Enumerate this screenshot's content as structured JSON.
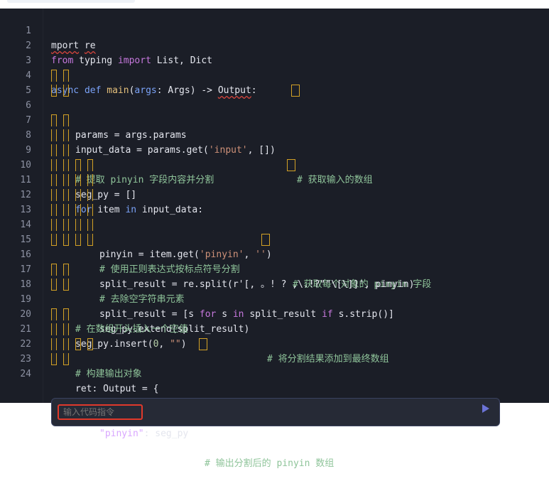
{
  "lines": [
    {
      "n": "1",
      "t": "mport re"
    },
    {
      "n": "2",
      "t": "from typing import List, Dict"
    },
    {
      "n": "3",
      "t": ""
    },
    {
      "n": "4",
      "t": "async def main(args: Args) -> Output:"
    },
    {
      "n": "5",
      "t": "params = args.params"
    },
    {
      "n": "6",
      "t": "input_data = params.get('input', [])",
      "c": "# 获取输入的数组"
    },
    {
      "n": "7",
      "t": ""
    },
    {
      "n": "8",
      "t": "",
      "c": "# 提取 pinyin 字段内容并分割"
    },
    {
      "n": "9",
      "t": "seg_py = []"
    },
    {
      "n": "10",
      "t": "for item in input_data:"
    },
    {
      "n": "11",
      "t": "pinyin = item.get('pinyin', '')",
      "c": "# 获取每个对象的 pinyin 字段"
    },
    {
      "n": "12",
      "t": "",
      "c": "# 使用正则表达式按标点符号分割"
    },
    {
      "n": "13",
      "t": "split_result = re.split(r'[, 。! ? ,\\.!?\"\"\\[\\]]', pinyin)"
    },
    {
      "n": "14",
      "t": "",
      "c": "# 去除空字符串元素"
    },
    {
      "n": "15",
      "t": "split_result = [s for s in split_result if s.strip()]"
    },
    {
      "n": "16",
      "t": "seg_py.extend(split_result)",
      "c": "# 将分割结果添加到最终数组"
    },
    {
      "n": "17",
      "t": ""
    },
    {
      "n": "18",
      "t": "",
      "c": "# 在数组开头插入一个空值"
    },
    {
      "n": "19",
      "t": "seg_py.insert(0, \"\")"
    },
    {
      "n": "20",
      "t": ""
    },
    {
      "n": "21",
      "t": "",
      "c": "# 构建输出对象"
    },
    {
      "n": "22",
      "t": "ret: Output = {"
    },
    {
      "n": "23",
      "t": "\"pinyin\": seg_py",
      "c": "# 输出分割后的 pinyin 数组"
    },
    {
      "n": "24",
      "t": "}"
    }
  ],
  "chat": {
    "placeholder": "输入代码指令"
  },
  "colors": {
    "background": "#1b1e27",
    "guide": "#d3a126",
    "comment": "#8fc49a",
    "keyword": "#c678dd",
    "highlight_border": "#e0392b"
  }
}
